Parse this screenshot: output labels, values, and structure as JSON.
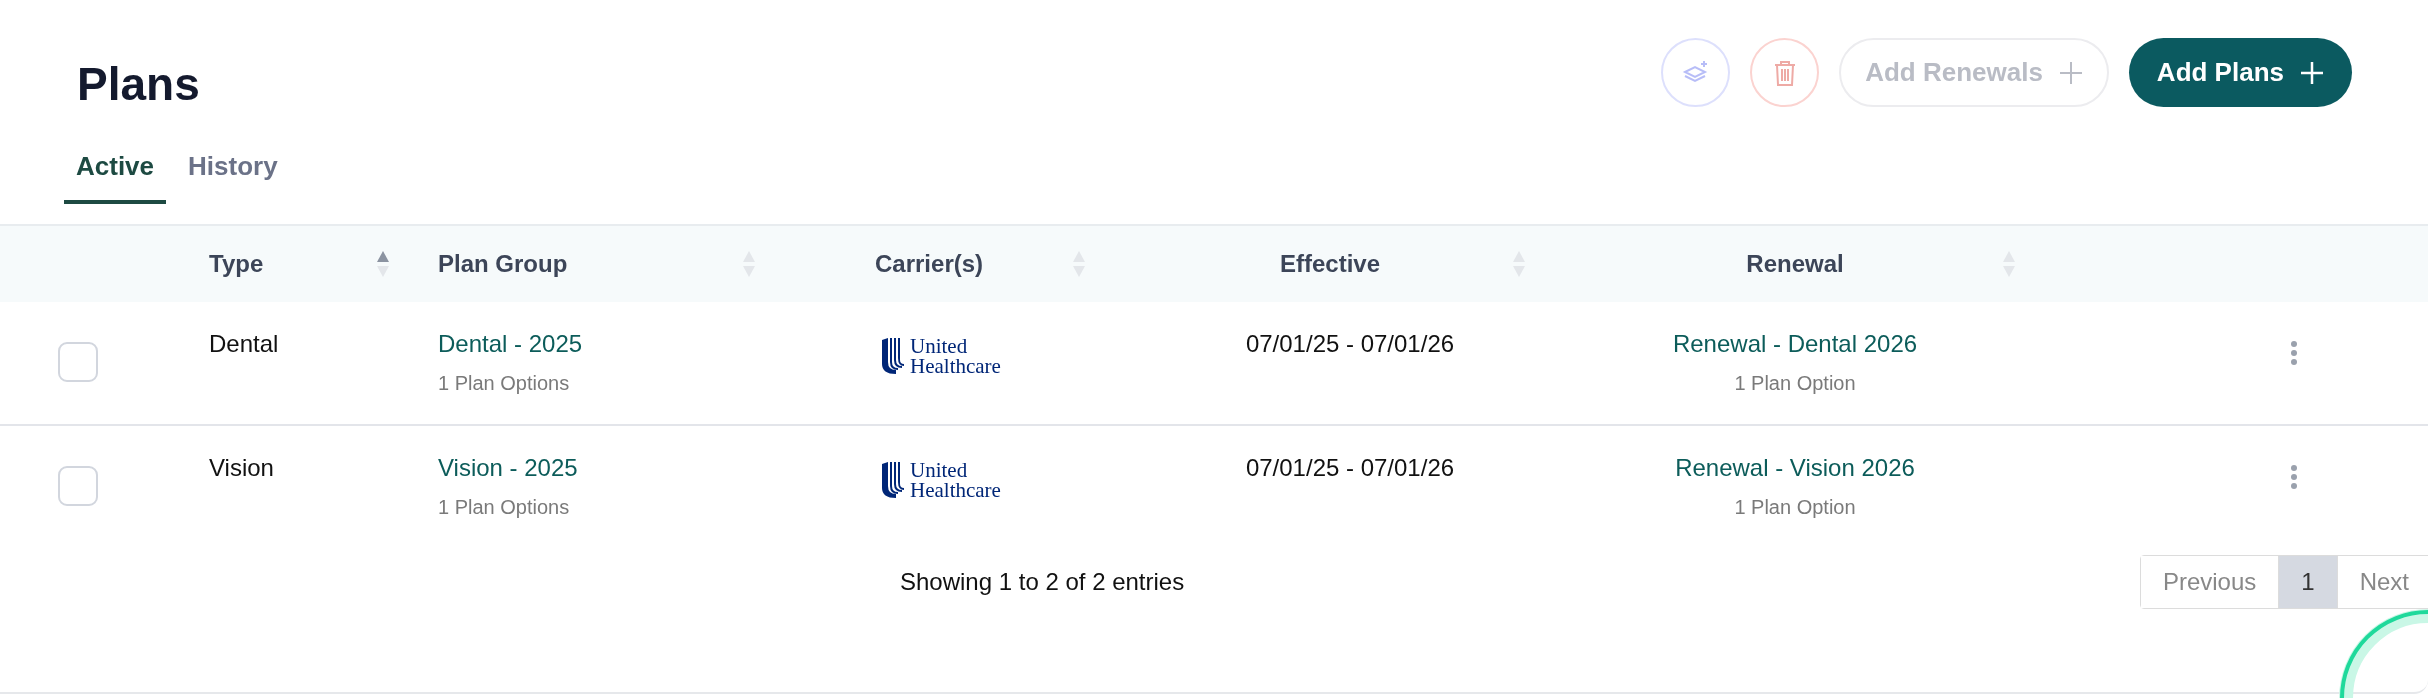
{
  "title": "Plans",
  "actions": [
    {
      "kind": "layers",
      "disabled": true
    },
    {
      "kind": "trash",
      "disabled": true
    },
    {
      "kind": "text",
      "label": "Add Renewals",
      "disabled": true
    },
    {
      "kind": "primary",
      "label": "Add Plans",
      "disabled": false
    }
  ],
  "tabs": [
    {
      "label": "Active",
      "selected": true
    },
    {
      "label": "History",
      "selected": false
    }
  ],
  "table": {
    "columns": [
      {
        "label": "Type",
        "sorted_ascending": true
      },
      {
        "label": "Plan Group",
        "sorted_ascending": false
      },
      {
        "label": "Carrier(s)",
        "sorted_ascending": false
      },
      {
        "label": "Effective",
        "sorted_ascending": false
      },
      {
        "label": "Renewal",
        "sorted_ascending": false
      }
    ],
    "rows": [
      {
        "checked": false,
        "type": "Dental",
        "plan_group": "Dental - 2025",
        "plan_options": "1 Plan Options",
        "carrier": [
          "United",
          "Healthcare"
        ],
        "effective": "07/01/25 - 07/01/26",
        "renewal": "Renewal - Dental 2026",
        "renewal_options": "1 Plan Option"
      },
      {
        "checked": false,
        "type": "Vision",
        "plan_group": "Vision - 2025",
        "plan_options": "1 Plan Options",
        "carrier": [
          "United",
          "Healthcare"
        ],
        "effective": "07/01/25 - 07/01/26",
        "renewal": "Renewal - Vision 2026",
        "renewal_options": "1 Plan Option"
      }
    ]
  },
  "footer": {
    "summary": "Showing 1 to 2 of 2 entries",
    "pagination": [
      {
        "label": "Previous",
        "selected": false
      },
      {
        "label": "1",
        "selected": true
      },
      {
        "label": "Next",
        "selected": false
      }
    ]
  }
}
